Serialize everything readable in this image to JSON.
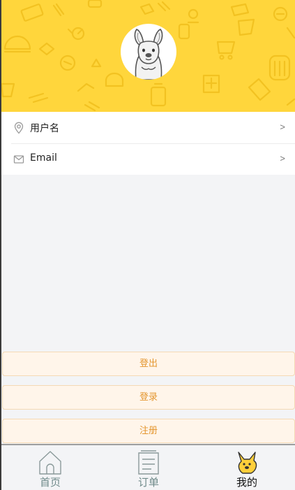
{
  "profile": {
    "avatar_icon": "kangaroo-avatar-icon",
    "header_color": "#ffd63c"
  },
  "list": [
    {
      "icon": "location-pin-icon",
      "label": "用户名",
      "chevron": ">"
    },
    {
      "icon": "mail-icon",
      "label": "Email",
      "chevron": ">"
    }
  ],
  "buttons": {
    "logout": "登出",
    "login": "登录",
    "register": "注册"
  },
  "tabs": [
    {
      "icon": "home-icon",
      "label": "首页",
      "active": false
    },
    {
      "icon": "order-list-icon",
      "label": "订单",
      "active": false
    },
    {
      "icon": "kangaroo-icon",
      "label": "我的",
      "active": true
    }
  ],
  "colors": {
    "accent": "#e4962f",
    "button_bg": "#fff5ea",
    "tab_inactive": "#6f8a8a",
    "tab_active": "#111111"
  }
}
